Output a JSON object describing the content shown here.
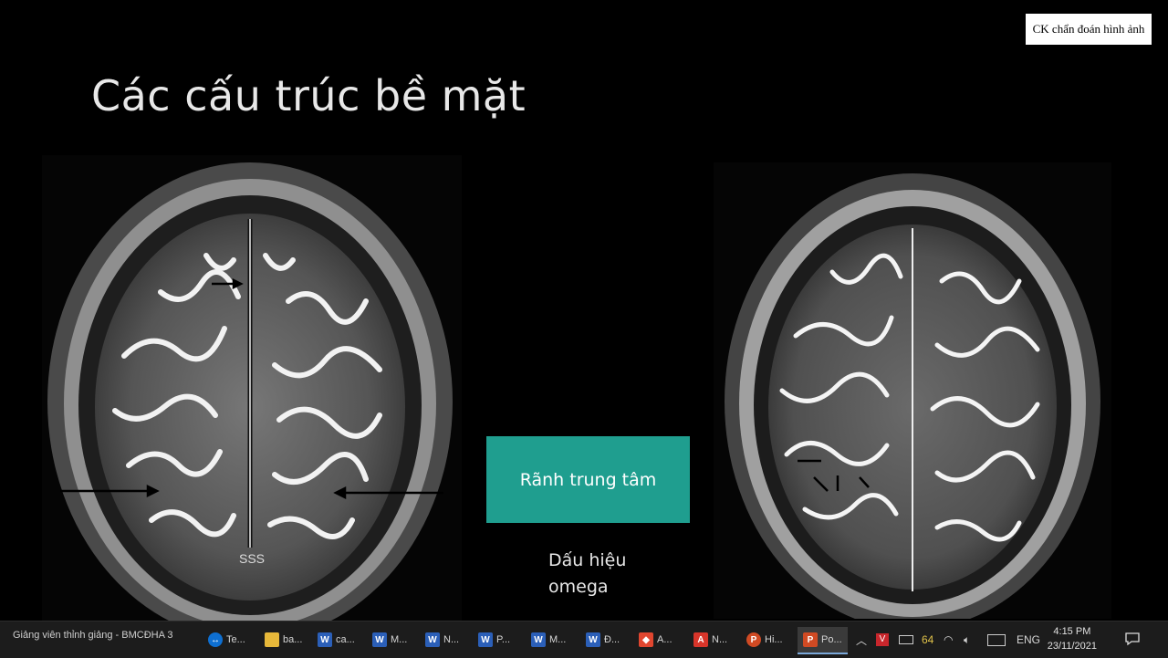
{
  "slide": {
    "title": "Các cấu trúc bề mặt",
    "watermark": "CK chẩn đoán hình ảnh",
    "left_scan_label": "SSS",
    "callout_box": "Rãnh trung tâm",
    "sign_line1": "Dấu hiệu",
    "sign_line2": "omega",
    "accent_color": "#1f9e8f"
  },
  "taskbar": {
    "meeting_label": "Giảng viên thỉnh giảng - BMCĐHA 3",
    "items": [
      {
        "label": "Te...",
        "icon": "teamviewer-icon",
        "color": "#0e6fd1"
      },
      {
        "label": "ba...",
        "icon": "folder-icon",
        "color": "#e7b83a"
      },
      {
        "label": "ca...",
        "icon": "word-icon",
        "color": "#2b5fb8"
      },
      {
        "label": "M...",
        "icon": "word-icon",
        "color": "#2b5fb8"
      },
      {
        "label": "N...",
        "icon": "word-icon",
        "color": "#2b5fb8"
      },
      {
        "label": "P...",
        "icon": "word-icon",
        "color": "#2b5fb8"
      },
      {
        "label": "M...",
        "icon": "word-icon",
        "color": "#2b5fb8"
      },
      {
        "label": "Đ...",
        "icon": "word-icon",
        "color": "#2b5fb8"
      },
      {
        "label": "A...",
        "icon": "anydesk-icon",
        "color": "#e0462f"
      },
      {
        "label": "N...",
        "icon": "pdf-icon",
        "color": "#d8352a"
      },
      {
        "label": "Hi...",
        "icon": "powerpoint-icon",
        "color": "#d04a23"
      },
      {
        "label": "Po...",
        "icon": "powerpoint-icon",
        "color": "#d04a23"
      }
    ],
    "tray_number": "64",
    "language": "ENG",
    "time": "4:15 PM",
    "date": "23/11/2021"
  }
}
